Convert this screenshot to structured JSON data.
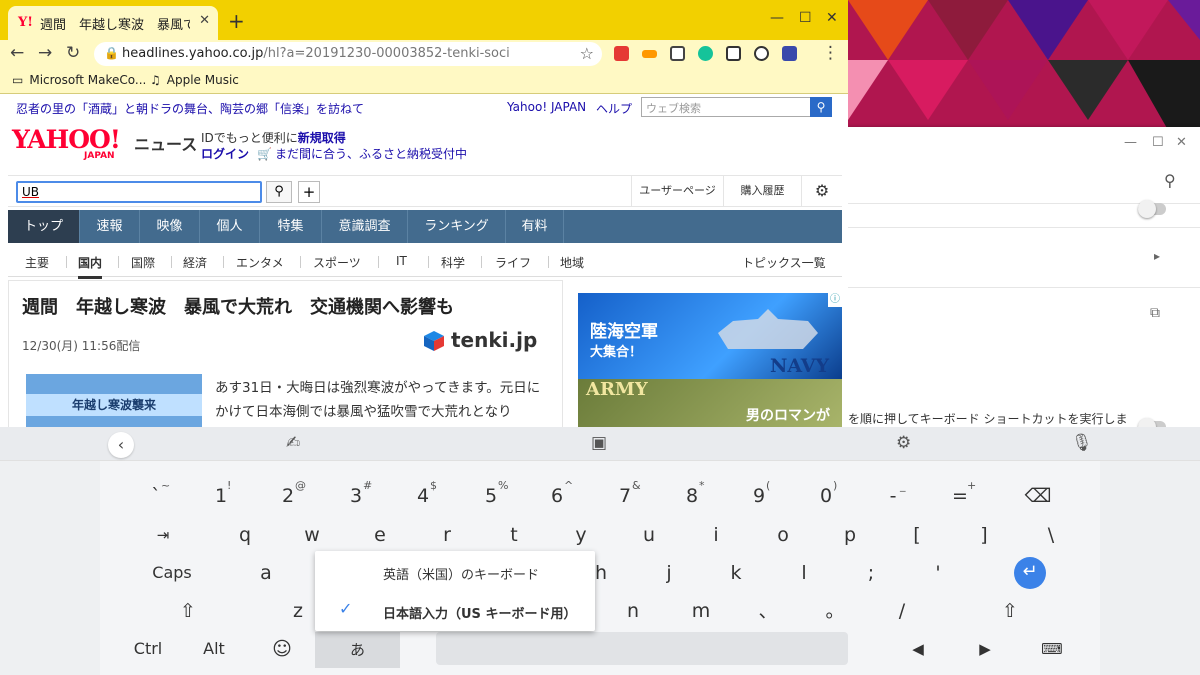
{
  "browser": {
    "tab_title": "週間　年越し寒波　暴風で大荒",
    "favicon": "Y!",
    "url_host": "headlines.yahoo.co.jp",
    "url_path": "/hl?a=20191230-00003852-tenki-soci",
    "bookmarks": [
      {
        "label": "Microsoft MakeCo..."
      },
      {
        "label": "Apple Music"
      }
    ]
  },
  "yahoo": {
    "pr_link": "忍者の里の「酒蔵」と朝ドラの舞台、陶芸の郷「信楽」を訪ねて",
    "top_links": [
      "Yahoo! JAPAN",
      "ヘルプ"
    ],
    "web_search_placeholder": "ウェブ検索",
    "logo_main": "YAHOO!",
    "logo_sub": "JAPAN",
    "logo_news": "ニュース",
    "id_line_prefix": "IDでもっと便利に",
    "id_line_link": "新規取得",
    "login": "ログイン",
    "furusato": "まだ間に合う、ふるさと納税受付中",
    "search_value": "UB",
    "account_links": [
      "ユーザーページ",
      "購入履歴"
    ],
    "main_nav": [
      "トップ",
      "速報",
      "映像",
      "個人",
      "特集",
      "意識調査",
      "ランキング",
      "有料"
    ],
    "sub_nav": [
      "主要",
      "国内",
      "国際",
      "経済",
      "エンタメ",
      "スポーツ",
      "IT",
      "科学",
      "ライフ",
      "地域"
    ],
    "topics_list": "トピックス一覧",
    "article": {
      "headline": "週間　年越し寒波　暴風で大荒れ　交通機関へ影響も",
      "date": "12/30(月) 11:56配信",
      "source": "tenki.jp",
      "thumb_text": "年越し寒波襲来",
      "body": "あす31日・大晦日は強烈寒波がやってきます。元日にかけて日本海側では暴風や猛吹雪で大荒れとなり"
    },
    "ad": {
      "title": "陸海空軍",
      "subtitle": "大集合！",
      "navy": "NAVY",
      "army": "ARMY",
      "tagline": "男のロマンが"
    }
  },
  "settings_window": {
    "shortcut_text": "を順に押してキーボード ショートカットを実行しま"
  },
  "keyboard": {
    "row1": [
      {
        "k": "`",
        "s": "~"
      },
      {
        "k": "1",
        "s": "!"
      },
      {
        "k": "2",
        "s": "@"
      },
      {
        "k": "3",
        "s": "#"
      },
      {
        "k": "4",
        "s": "$"
      },
      {
        "k": "5",
        "s": "%"
      },
      {
        "k": "6",
        "s": "^"
      },
      {
        "k": "7",
        "s": "&"
      },
      {
        "k": "8",
        "s": "*"
      },
      {
        "k": "9",
        "s": "("
      },
      {
        "k": "0",
        "s": ")"
      },
      {
        "k": "-",
        "s": "_"
      },
      {
        "k": "=",
        "s": "+"
      }
    ],
    "row2": [
      "q",
      "w",
      "e",
      "r",
      "t",
      "y",
      "u",
      "i",
      "o",
      "p",
      "[",
      "]",
      "\\"
    ],
    "row3_left": [
      "a"
    ],
    "row3_right": [
      "h",
      "j",
      "k",
      "l",
      ";",
      "'"
    ],
    "row4_left": [
      "z"
    ],
    "row4_right": [
      "n",
      "m",
      "、",
      "。",
      "/"
    ],
    "caps": "Caps",
    "ctrl": "Ctrl",
    "alt": "Alt",
    "kana": "あ",
    "ime_menu": {
      "option1": "英語（米国）のキーボード",
      "option2": "日本語入力（US キーボード用）"
    }
  }
}
